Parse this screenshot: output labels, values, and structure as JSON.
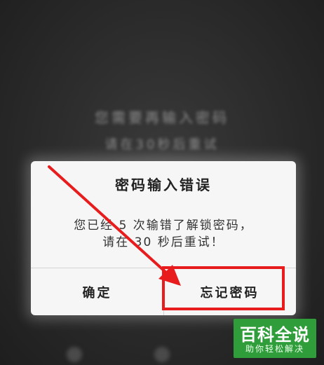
{
  "background": {
    "line1": "您需要再输入密码",
    "line2": "请在30秒后重试"
  },
  "dialog": {
    "title": "密码输入错误",
    "message_line1": "您已经 5 次输错了解锁密码，",
    "message_line2": "请在 30 秒后重试！",
    "confirm_label": "确定",
    "forgot_label": "忘记密码"
  },
  "annotation": {
    "color": "#e81c1c"
  },
  "watermark": {
    "main": "百科全说",
    "sub": "助你轻松解决",
    "color": "#2e9d3a"
  }
}
